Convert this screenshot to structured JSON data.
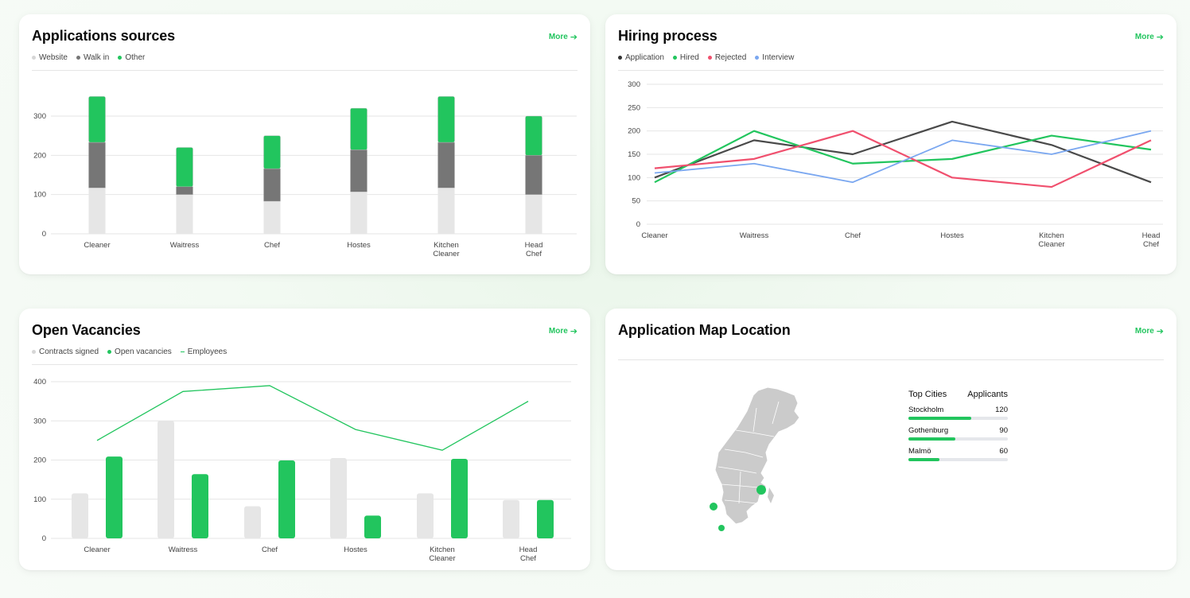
{
  "colors": {
    "green": "#22c55e",
    "dark_gray": "#767676",
    "light_gray": "#e5e5e5",
    "charcoal": "#4a4a4a",
    "red": "#f0506e",
    "blue": "#7aa7f0"
  },
  "more_label": "More",
  "more_icon": "arrow-right-icon",
  "sources": {
    "title": "Applications sources",
    "legend": [
      "Website",
      "Walk in",
      "Other"
    ]
  },
  "hiring": {
    "title": "Hiring process",
    "legend": [
      "Application",
      "Hired",
      "Rejected",
      "Interview"
    ]
  },
  "vacancies": {
    "title": "Open Vacancies",
    "legend": [
      "Contracts signed",
      "Open vacancies",
      "Employees"
    ]
  },
  "map": {
    "title": "Application Map Location",
    "col_city": "Top Cities",
    "col_applicants": "Applicants",
    "cities": [
      {
        "name": "Stockholm",
        "value": "120",
        "fraction": 0.63
      },
      {
        "name": "Gothenburg",
        "value": "90",
        "fraction": 0.47
      },
      {
        "name": "Malmö",
        "value": "60",
        "fraction": 0.31
      }
    ]
  },
  "chart_data": [
    {
      "type": "bar",
      "title": "Applications sources",
      "stacked": true,
      "categories": [
        [
          "Cleaner"
        ],
        [
          "Waitress"
        ],
        [
          "Chef"
        ],
        [
          "Hostes"
        ],
        [
          "Kitchen",
          "Cleaner"
        ],
        [
          "Head",
          "Chef"
        ]
      ],
      "series": [
        {
          "name": "Website",
          "values": [
            117,
            100,
            83,
            107,
            117,
            100
          ]
        },
        {
          "name": "Walk in",
          "values": [
            116,
            20,
            83,
            107,
            116,
            100
          ]
        },
        {
          "name": "Other",
          "values": [
            117,
            100,
            84,
            106,
            117,
            100
          ]
        }
      ],
      "yticks": [
        0,
        100,
        200,
        300
      ],
      "ylim": [
        0,
        350
      ],
      "grid": true
    },
    {
      "type": "line",
      "title": "Hiring process",
      "categories": [
        [
          "Cleaner"
        ],
        [
          "Waitress"
        ],
        [
          "Chef"
        ],
        [
          "Hostes"
        ],
        [
          "Kitchen",
          "Cleaner"
        ],
        [
          "Head",
          "Chef"
        ]
      ],
      "series": [
        {
          "name": "Application",
          "values": [
            100,
            180,
            150,
            220,
            170,
            90
          ]
        },
        {
          "name": "Hired",
          "values": [
            90,
            200,
            130,
            140,
            190,
            160
          ]
        },
        {
          "name": "Rejected",
          "values": [
            120,
            140,
            200,
            100,
            80,
            180
          ]
        },
        {
          "name": "Interview",
          "values": [
            110,
            130,
            90,
            180,
            150,
            200
          ]
        }
      ],
      "yticks": [
        0,
        50,
        100,
        150,
        200,
        250,
        300
      ],
      "ylim": [
        0,
        300
      ],
      "grid": true
    },
    {
      "type": "bar",
      "title": "Open Vacancies",
      "categories": [
        [
          "Cleaner"
        ],
        [
          "Waitress"
        ],
        [
          "Chef"
        ],
        [
          "Hostes"
        ],
        [
          "Kitchen",
          "Cleaner"
        ],
        [
          "Head",
          "Chef"
        ]
      ],
      "series": [
        {
          "name": "Contracts signed",
          "values": [
            115,
            300,
            82,
            205,
            115,
            98
          ]
        },
        {
          "name": "Open vacancies",
          "values": [
            209,
            164,
            199,
            58,
            203,
            98
          ]
        },
        {
          "name": "Employees",
          "type": "line",
          "values": [
            250,
            375,
            390,
            278,
            225,
            350
          ]
        }
      ],
      "yticks": [
        0,
        100,
        200,
        300,
        400
      ],
      "ylim": [
        0,
        400
      ],
      "grid": true
    }
  ]
}
